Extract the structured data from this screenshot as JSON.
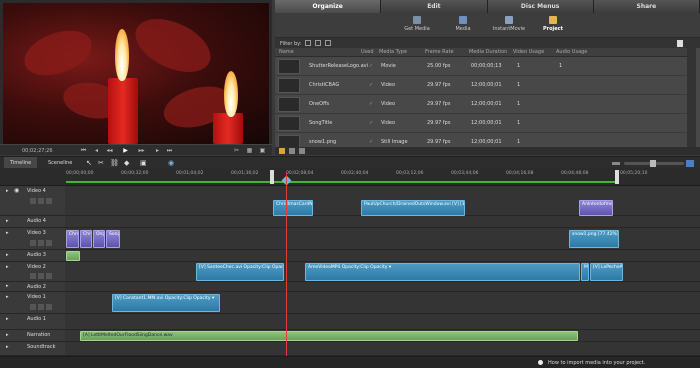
{
  "preview": {
    "timecode": "00;02;27;26",
    "controls": [
      "jump-back",
      "step-back",
      "rewind",
      "play",
      "fast-forward",
      "step-forward",
      "jump-forward"
    ]
  },
  "tabs": [
    {
      "label": "Organize",
      "active": true
    },
    {
      "label": "Edit",
      "active": false
    },
    {
      "label": "Disc Menus",
      "active": false
    },
    {
      "label": "Share",
      "active": false
    }
  ],
  "organize_tools": [
    {
      "label": "Get Media",
      "active": false
    },
    {
      "label": "Media",
      "active": false
    },
    {
      "label": "InstantMovie",
      "active": false
    },
    {
      "label": "Project",
      "active": true
    }
  ],
  "filter_label": "Filter by:",
  "media_table": {
    "columns": [
      "Name",
      "Used",
      "Media Type",
      "Frame Rate",
      "Media Duration",
      "Video Usage",
      "Audio Usage"
    ],
    "rows": [
      {
        "name": "ShutterReleaseLogo.avi",
        "used": "✓",
        "type": "Movie",
        "frame_rate": "25.00 fps",
        "duration": "00;00;00;13",
        "video": "1",
        "audio": "1"
      },
      {
        "name": "ChristiCBAG",
        "used": "✓",
        "type": "Video",
        "frame_rate": "29.97 fps",
        "duration": "12;00;00;01",
        "video": "1",
        "audio": ""
      },
      {
        "name": "OneOffs",
        "used": "✓",
        "type": "Video",
        "frame_rate": "29.97 fps",
        "duration": "12;00;00;01",
        "video": "1",
        "audio": ""
      },
      {
        "name": "SongTitle",
        "used": "✓",
        "type": "Video",
        "frame_rate": "29.97 fps",
        "duration": "12;00;00;01",
        "video": "1",
        "audio": ""
      },
      {
        "name": "snow1.png",
        "used": "✓",
        "type": "Still Image",
        "frame_rate": "29.97 fps",
        "duration": "12;00;00;01",
        "video": "1",
        "audio": ""
      }
    ]
  },
  "timeline": {
    "tabs": [
      {
        "label": "Timeline",
        "active": true
      },
      {
        "label": "Sceneline",
        "active": false
      }
    ],
    "ruler_ticks": [
      "00;00;00;00",
      "00;00;32;00",
      "00;01;04;02",
      "00;01;36;02",
      "00;02;08;04",
      "00;02;40;04",
      "00;03;12;06",
      "00;03;44;06",
      "00;04;16;08",
      "00;04;48;08",
      "00;05;20;10"
    ],
    "tracks": [
      {
        "label": "Video 4"
      },
      {
        "label": "Audio 4"
      },
      {
        "label": "Video 3"
      },
      {
        "label": "Audio 3"
      },
      {
        "label": "Video 2"
      },
      {
        "label": "Audio 2"
      },
      {
        "label": "Video 1"
      },
      {
        "label": "Audio 1"
      },
      {
        "label": "Narration"
      },
      {
        "label": "Soundtrack"
      }
    ],
    "clips": {
      "v4a": "ChristmasCardNo3",
      "v4b": "PaulUpChurch/DrainedOutsWindow.avi [V] [175.75 %]",
      "v4c": "AnIntentofme_nm",
      "v3a": "Chrst",
      "v3b": "Chrst",
      "v3c": "Ong",
      "v3d": "Song",
      "v3e": "snow1.png [77.42%] [V]",
      "v2a": "[V] SanteeChec.avi Opacity:Clip Opacity ▾",
      "v2b": "AmeVideoMP4 Opacity:Clip Opacity ▾",
      "v2c": "Me",
      "v2d": "[V] LePecheArge Op",
      "v1a": "[V] Constant1.MM.avi Opacity:Clip Opacity ▾",
      "narration": "[A] LetItMeltedOurFloodSiingDance.wav"
    }
  },
  "status": {
    "hint": "How to import media into your project."
  }
}
